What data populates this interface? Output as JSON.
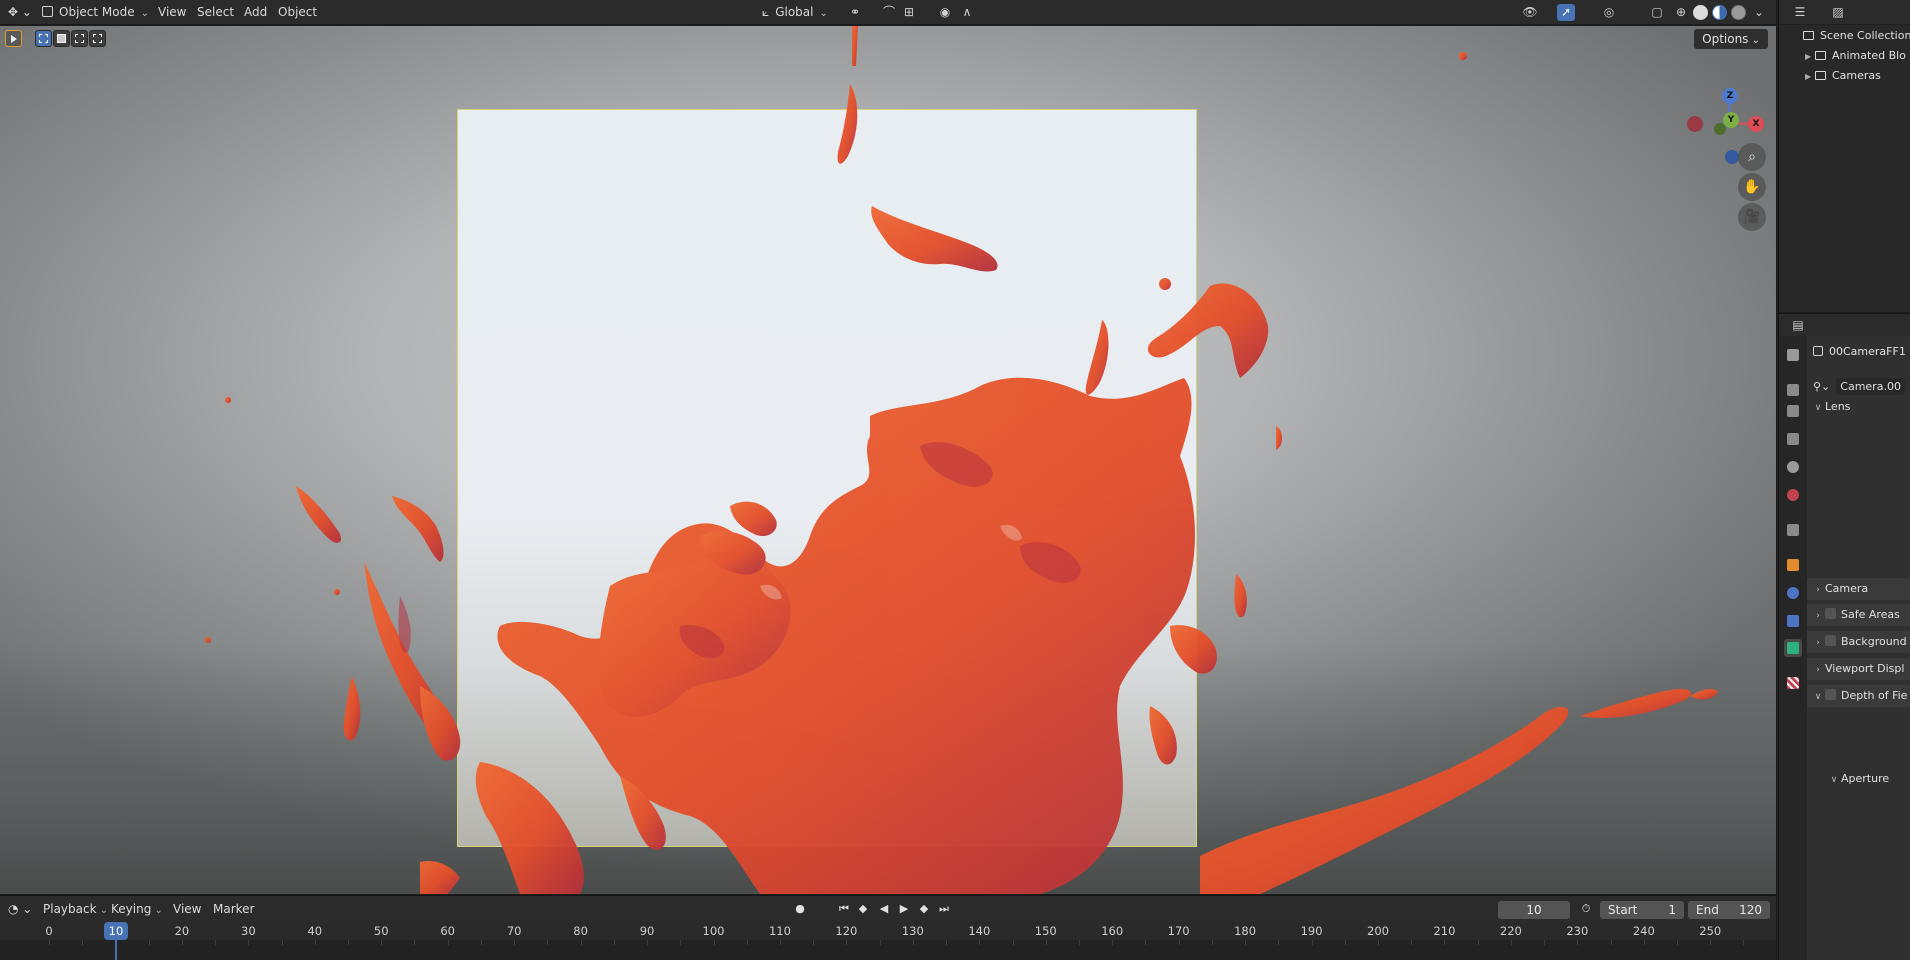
{
  "header": {
    "editor_type_icon": "3d-viewport-icon",
    "mode_label": "Object Mode",
    "menus": [
      "View",
      "Select",
      "Add",
      "Object"
    ],
    "transform_orientation": "Global",
    "options_label": "Options"
  },
  "outliner": {
    "items": [
      {
        "label": "Scene Collection",
        "depth": 0
      },
      {
        "label": "Animated Blo",
        "depth": 1
      },
      {
        "label": "Cameras",
        "depth": 1
      }
    ]
  },
  "properties": {
    "object_name": "00CameraFF1",
    "data_name": "Camera.00",
    "panels": [
      {
        "label": "Lens",
        "expanded": true,
        "checkbox": false
      },
      {
        "label": "Camera",
        "expanded": false,
        "checkbox": false
      },
      {
        "label": "Safe Areas",
        "expanded": false,
        "checkbox": true
      },
      {
        "label": "Background",
        "expanded": false,
        "checkbox": true
      },
      {
        "label": "Viewport Displ",
        "expanded": false,
        "checkbox": false
      },
      {
        "label": "Depth of Fie",
        "expanded": true,
        "checkbox": true
      },
      {
        "label": "Aperture",
        "expanded": true,
        "checkbox": false
      }
    ]
  },
  "timeline": {
    "menus": [
      "Playback",
      "Keying",
      "View",
      "Marker"
    ],
    "current_frame": "10",
    "start_label": "Start",
    "start_value": "1",
    "end_label": "End",
    "end_value": "120",
    "ruler_ticks": [
      "0",
      "10",
      "20",
      "30",
      "40",
      "50",
      "60",
      "70",
      "80",
      "90",
      "100",
      "110",
      "120",
      "130",
      "140",
      "150",
      "160",
      "170",
      "180",
      "190",
      "200",
      "210",
      "220",
      "230",
      "240",
      "250"
    ]
  },
  "gizmo": {
    "z_label": "Z",
    "y_label": "Y",
    "x_label": "X"
  },
  "colors": {
    "accent": "#4772b3",
    "splash_orange": "#e8542a",
    "splash_red": "#b8323f",
    "camera_frame": "#d7d27a"
  }
}
